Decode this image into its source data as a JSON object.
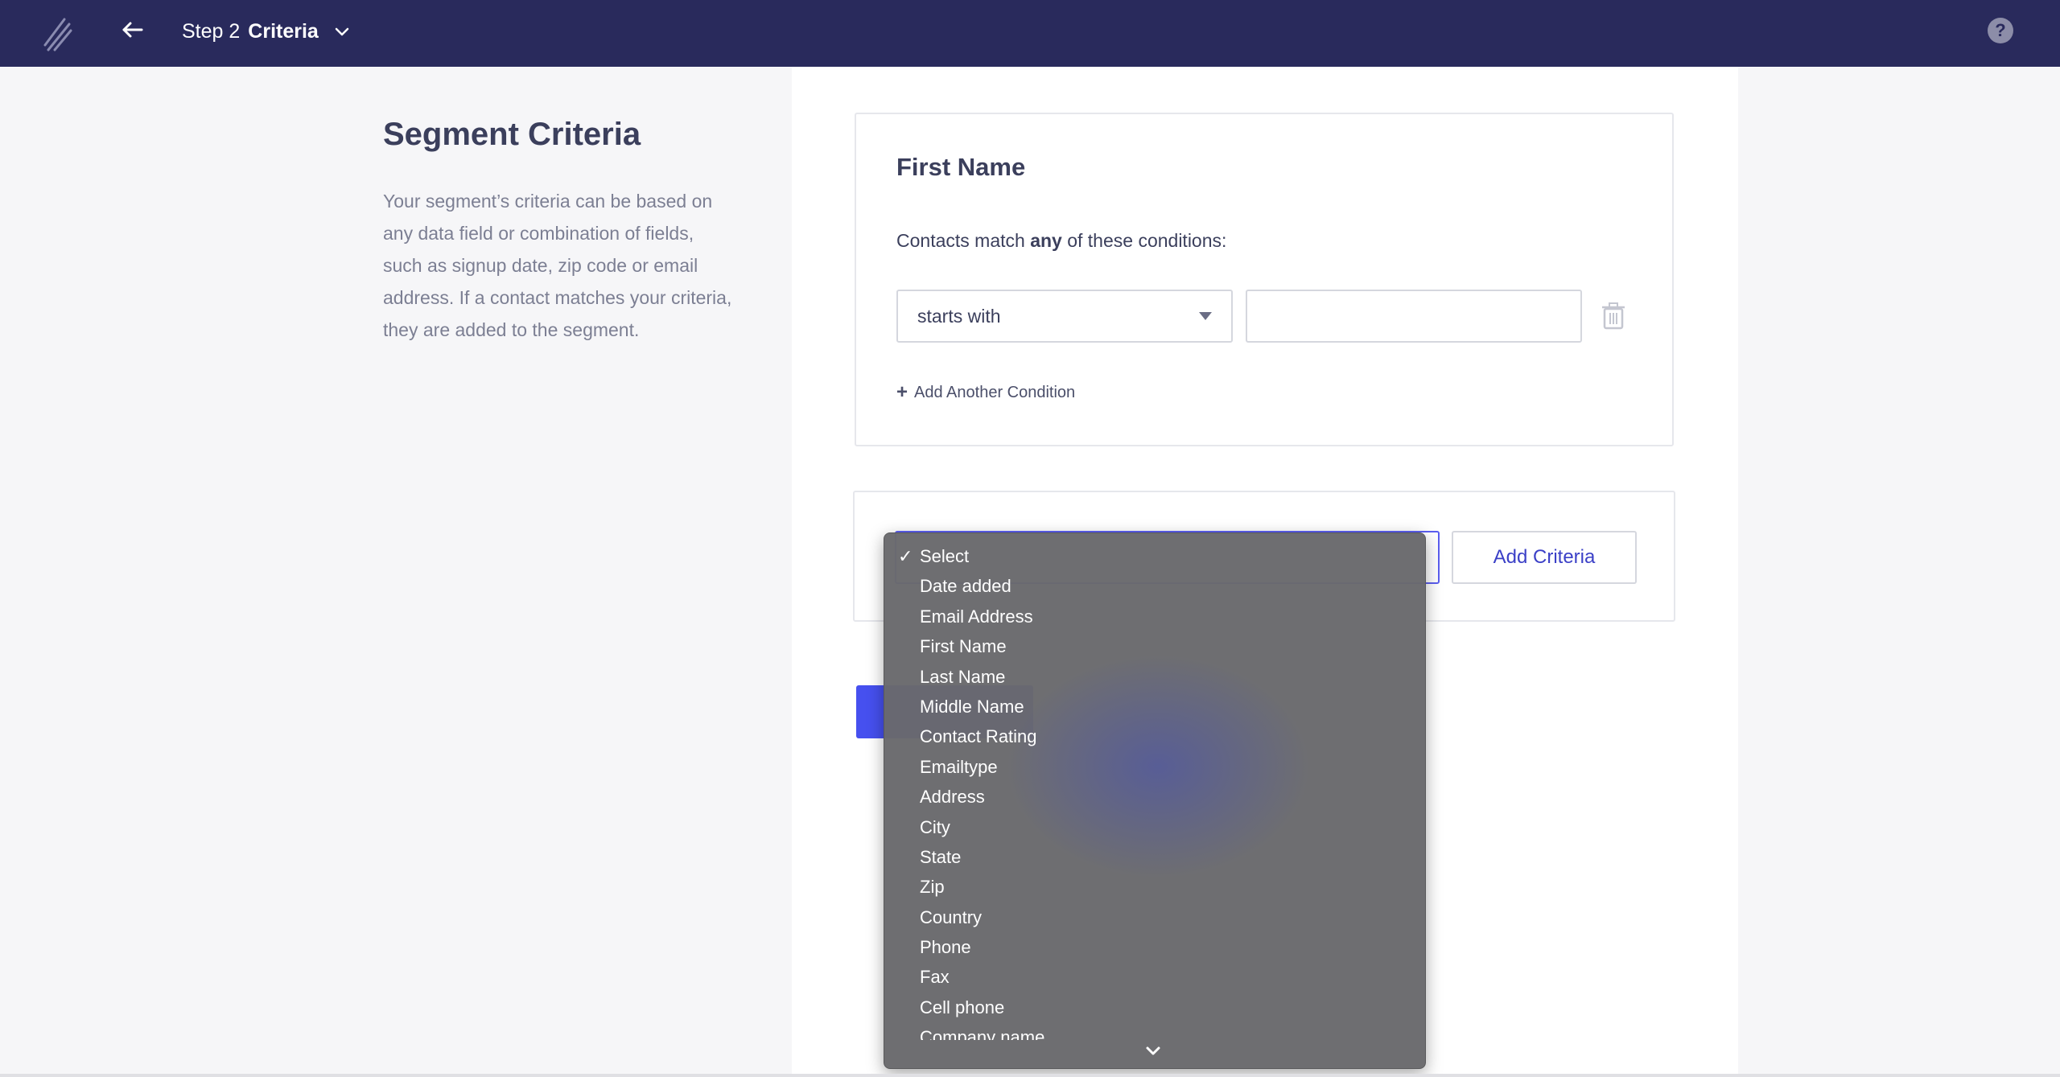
{
  "header": {
    "step_prefix": "Step 2",
    "step_name": "Criteria",
    "help_label": "?"
  },
  "sidebar": {
    "title": "Segment Criteria",
    "description": "Your segment’s criteria can be based on any data field or combination of fields, such as signup date, zip code or email address. If a contact matches your criteria, they are added to the segment."
  },
  "criteria_card": {
    "title": "First Name",
    "match_prefix": "Contacts match",
    "match_mode": "any",
    "match_suffix": "of these conditions:",
    "operator_value": "starts with",
    "value_input": "",
    "add_condition_label": "Add Another Condition"
  },
  "add_criteria": {
    "button_label": "Add Criteria"
  },
  "dropdown": {
    "selected": "Select",
    "options": [
      "Select",
      "Date added",
      "Email Address",
      "First Name",
      "Last Name",
      "Middle Name",
      "Contact Rating",
      "Emailtype",
      "Address",
      "City",
      "State",
      "Zip",
      "Country",
      "Phone",
      "Fax",
      "Cell phone",
      "Company name"
    ]
  },
  "colors": {
    "topbar": "#292a5c",
    "accent": "#4650ef",
    "link": "#3b40c7"
  }
}
